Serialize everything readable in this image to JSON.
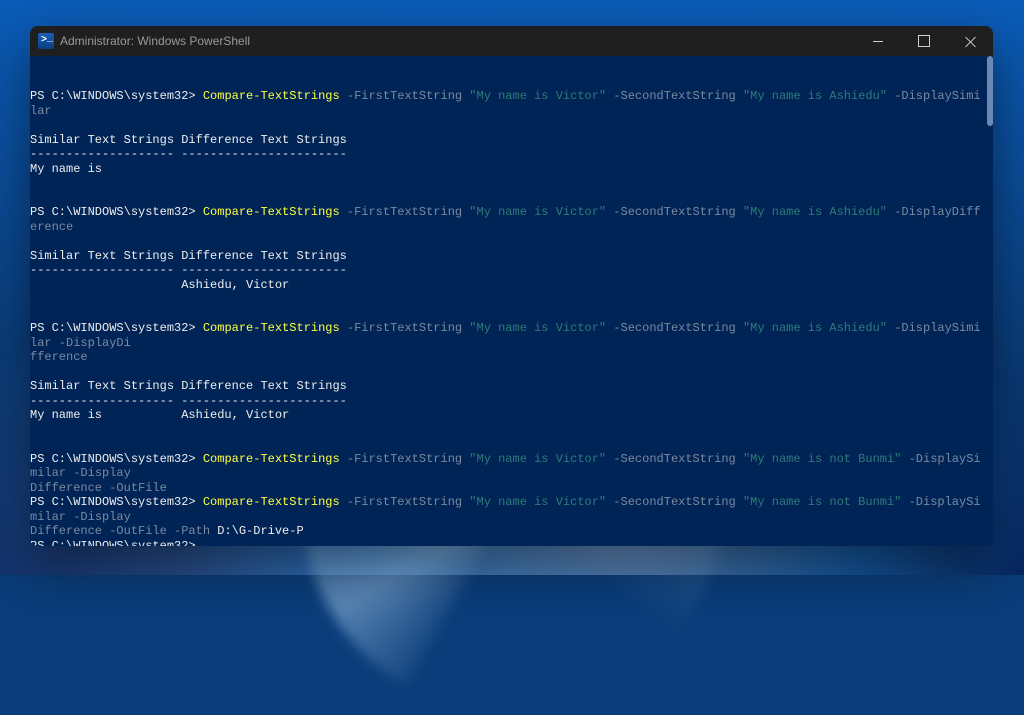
{
  "window": {
    "title": "Administrator: Windows PowerShell"
  },
  "prompt": "PS C:\\WINDOWS\\system32>",
  "cmd": "Compare-TextStrings",
  "param": {
    "first": "-FirstTextString",
    "second": "-SecondTextString",
    "dispSim": "-DisplaySimilar",
    "dispDiff": "-DisplayDifference",
    "dispDiffWrapA": "-DisplayDi",
    "dispDiffWrapB": "fference",
    "dispWord": "-Display",
    "diffWord": "Difference",
    "outFile": "-OutFile",
    "path": "-Path"
  },
  "strings": {
    "victor": "\"My name is Victor\"",
    "ashiedu": "\"My name is Ashiedu\"",
    "notBunmi": "\"My name is not Bunmi\""
  },
  "pathValue": "D:\\G-Drive-P",
  "output": {
    "header": "Similar Text Strings Difference Text Strings",
    "divider": "-------------------- -----------------------",
    "sim": "My name is",
    "diff": "                     Ashiedu, Victor",
    "both": "My name is           Ashiedu, Victor"
  }
}
